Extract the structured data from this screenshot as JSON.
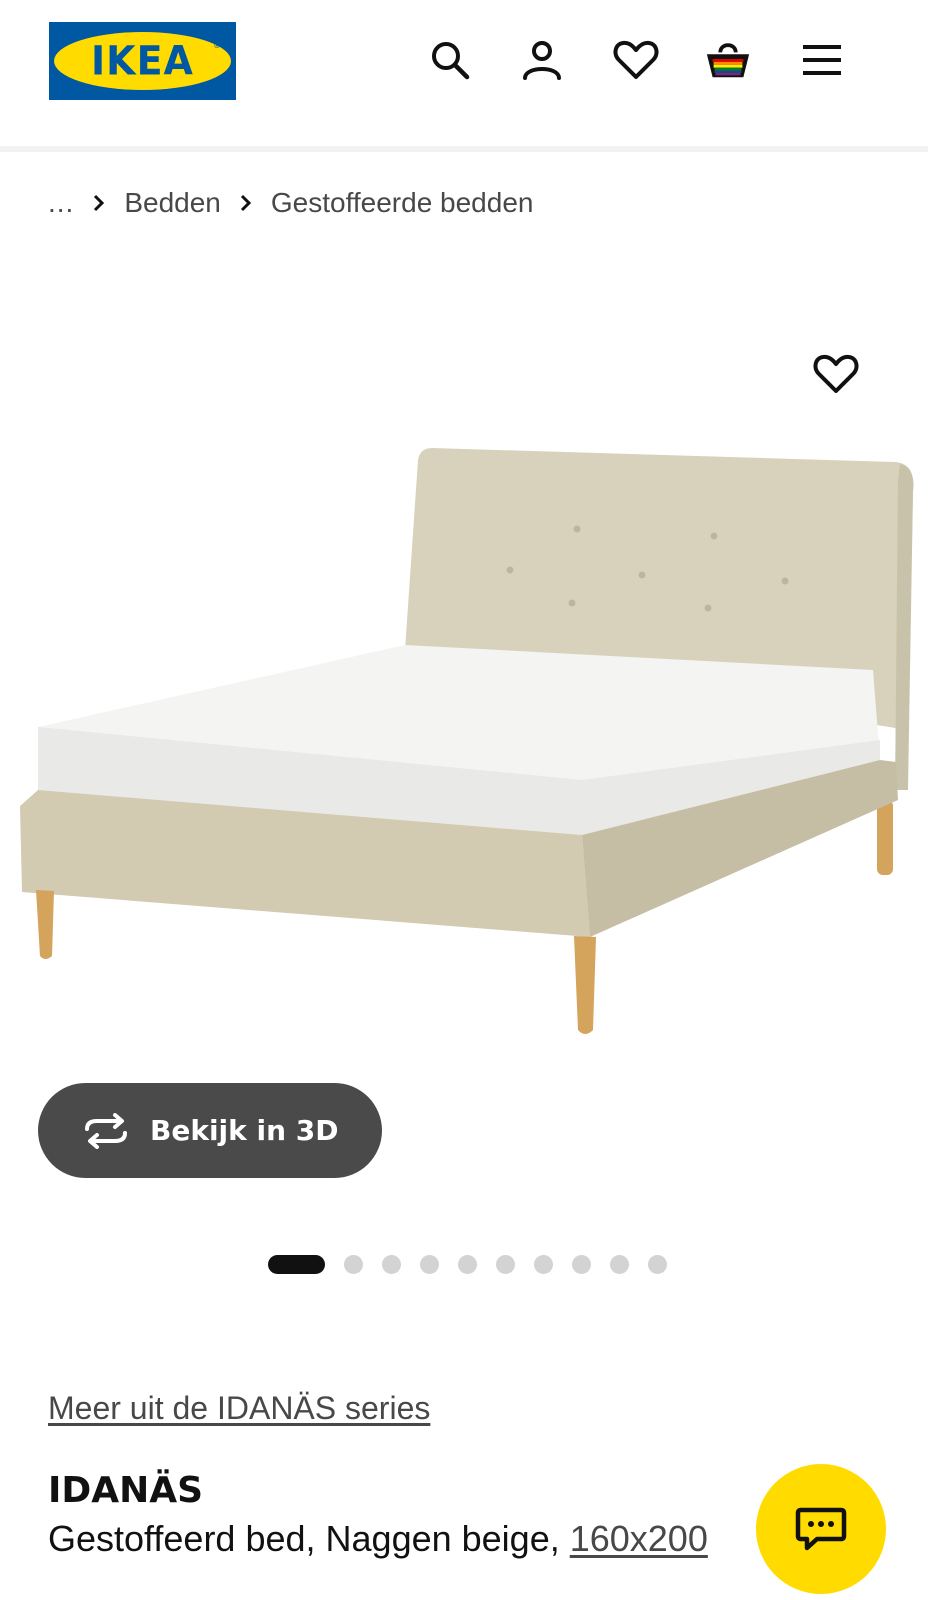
{
  "header": {
    "logo_text": "IKEA",
    "logo_reg": "®",
    "icons": [
      "search-icon",
      "user-icon",
      "heart-icon",
      "basket-icon",
      "menu-icon"
    ],
    "colors": {
      "brand_blue": "#0058a3",
      "brand_yellow": "#ffdb00"
    }
  },
  "breadcrumb": {
    "ellipsis": "...",
    "items": [
      "Bedden",
      "Gestoffeerde bedden"
    ]
  },
  "gallery": {
    "view_3d_label": "Bekijk in 3D",
    "image_count": 10,
    "active_index": 0
  },
  "product": {
    "series_link": "Meer uit de IDANÄS series",
    "name": "IDANÄS",
    "description": "Gestoffeerd bed, Naggen beige, ",
    "size": "160x200"
  },
  "chat": {
    "icon": "chat-icon",
    "color": "#ffdb00"
  }
}
